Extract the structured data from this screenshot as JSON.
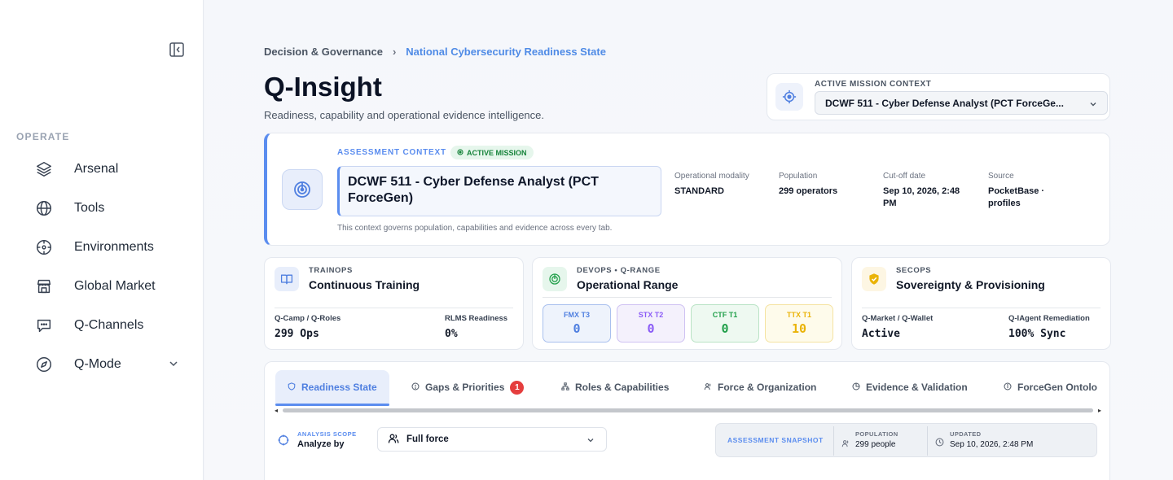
{
  "sidebar": {
    "section_label": "OPERATE",
    "items": [
      {
        "label": "Arsenal",
        "icon": "layers-icon"
      },
      {
        "label": "Tools",
        "icon": "globe-icon"
      },
      {
        "label": "Environments",
        "icon": "crosshair-icon"
      },
      {
        "label": "Global Market",
        "icon": "store-icon"
      },
      {
        "label": "Q-Channels",
        "icon": "message-icon"
      },
      {
        "label": "Q-Mode",
        "icon": "compass-icon"
      }
    ]
  },
  "breadcrumb": {
    "parent": "Decision & Governance",
    "separator": "›",
    "current": "National Cybersecurity Readiness State"
  },
  "header": {
    "title": "Q-Insight",
    "subtitle": "Readiness, capability and operational evidence intelligence."
  },
  "mission_context": {
    "label": "ACTIVE MISSION CONTEXT",
    "selected": "DCWF 511 - Cyber Defense Analyst (PCT ForceGe..."
  },
  "assessment": {
    "label": "ASSESSMENT CONTEXT",
    "badge": "ACTIVE MISSION",
    "name": "DCWF 511 - Cyber Defense Analyst (PCT ForceGen)",
    "note": "This context governs population, capabilities and evidence across every tab.",
    "meta": [
      {
        "key": "Operational modality",
        "value": "STANDARD"
      },
      {
        "key": "Population",
        "value": "299 operators"
      },
      {
        "key": "Cut-off date",
        "value": "Sep 10, 2026, 2:48 PM"
      },
      {
        "key": "Source",
        "value": "PocketBase · profiles"
      }
    ]
  },
  "cards": {
    "trainops": {
      "tag": "TRAINOPS",
      "title": "Continuous Training",
      "stats": [
        {
          "key": "Q-Camp / Q-Roles",
          "value": "299 Ops"
        },
        {
          "key": "RLMS Readiness",
          "value": "0%"
        }
      ]
    },
    "devops": {
      "tag": "DEVOPS • Q-RANGE",
      "title": "Operational Range",
      "tiers": [
        {
          "name": "FMX T3",
          "value": "0",
          "color": "#4f7fe0"
        },
        {
          "name": "STX T2",
          "value": "0",
          "color": "#8b5cf6"
        },
        {
          "name": "CTF T1",
          "value": "0",
          "color": "#22a04b"
        },
        {
          "name": "TTX T1",
          "value": "10",
          "color": "#eab308"
        }
      ]
    },
    "secops": {
      "tag": "SECOPS",
      "title": "Sovereignty & Provisioning",
      "stats": [
        {
          "key": "Q-Market / Q-Wallet",
          "value": "Active"
        },
        {
          "key": "Q-IAgent Remediation",
          "value": "100% Sync"
        }
      ]
    }
  },
  "tabs": [
    {
      "label": "Readiness State",
      "icon": "shield-icon",
      "active": true
    },
    {
      "label": "Gaps & Priorities",
      "icon": "alert-circle-icon",
      "badge": "1"
    },
    {
      "label": "Roles & Capabilities",
      "icon": "hierarchy-icon"
    },
    {
      "label": "Force & Organization",
      "icon": "users-icon"
    },
    {
      "label": "Evidence & Validation",
      "icon": "pie-icon"
    },
    {
      "label": "ForceGen Ontolo",
      "icon": "info-icon"
    }
  ],
  "scope": {
    "label": "ANALYSIS SCOPE",
    "value": "Analyze by",
    "selected": "Full force"
  },
  "snapshot": {
    "label": "ASSESSMENT SNAPSHOT",
    "population_label": "POPULATION",
    "population": "299 people",
    "updated_label": "UPDATED",
    "updated": "Sep 10, 2026, 2:48 PM"
  }
}
